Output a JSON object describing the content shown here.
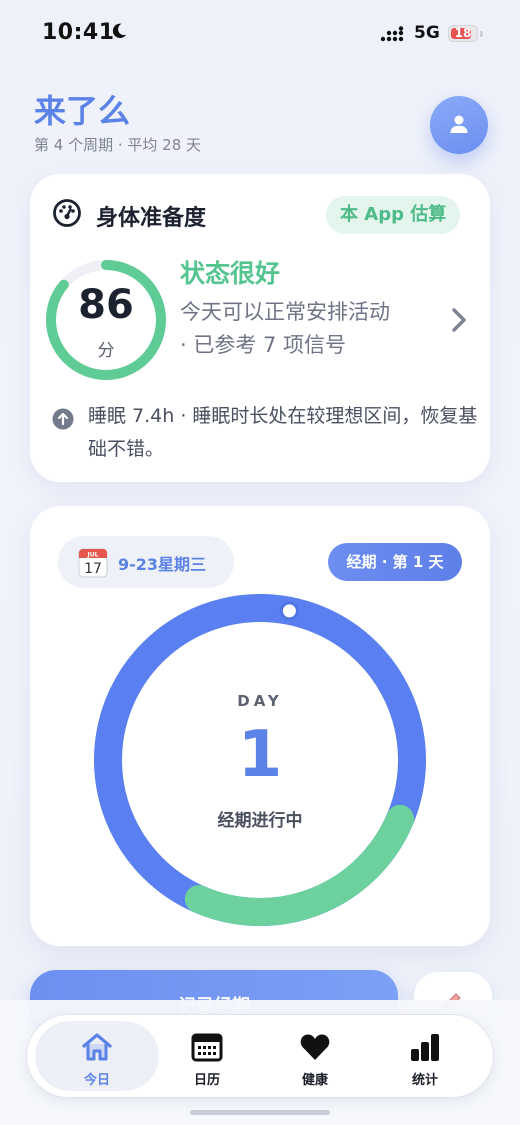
{
  "status_bar": {
    "time": "10:41",
    "network": "5G",
    "battery": "18"
  },
  "header": {
    "title": "来了么",
    "subtitle": "第 4 个周期 · 平均 28 天"
  },
  "readiness": {
    "title": "身体准备度",
    "badge": "本 App 估算",
    "score": "86",
    "score_value": 86,
    "score_unit": "分",
    "status_title": "状态很好",
    "status_desc": "今天可以正常安排活动 · 已参考 7 项信号",
    "sleep_note": "睡眠 7.4h · 睡眠时长处在较理想区间，恢复基础不错。"
  },
  "cycle": {
    "date_label": "9-23星期三",
    "calendar_month": "JUL",
    "calendar_day": "17",
    "period_badge": "经期 · 第 1 天",
    "day_label": "DAY",
    "day_number": "1",
    "day_status": "经期进行中"
  },
  "actions": {
    "record_label": "记录经期"
  },
  "tabs": [
    {
      "label": "今日",
      "icon": "home-icon",
      "active": true
    },
    {
      "label": "日历",
      "icon": "calendar-icon",
      "active": false
    },
    {
      "label": "健康",
      "icon": "heart-icon",
      "active": false
    },
    {
      "label": "统计",
      "icon": "bar-chart-icon",
      "active": false
    }
  ],
  "colors": {
    "accent": "#5b82e6",
    "success": "#55c58f",
    "ring_blue": "#5a7ff0",
    "ring_green": "#6dd19e"
  }
}
